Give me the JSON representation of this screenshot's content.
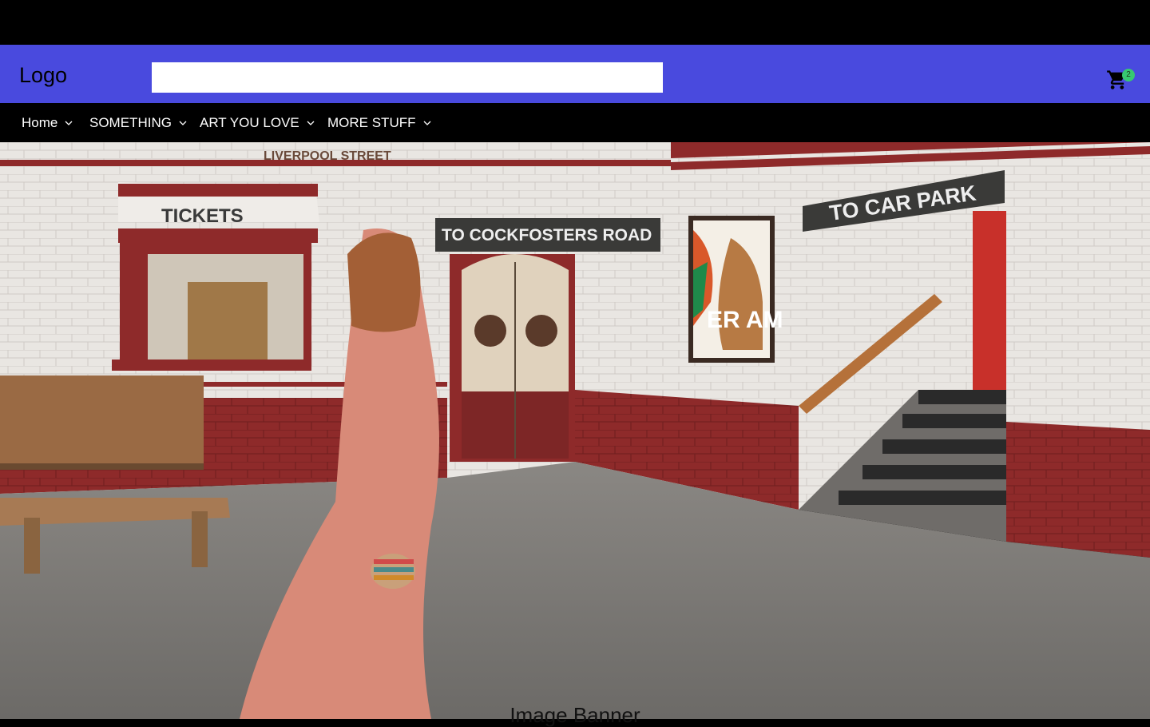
{
  "header": {
    "logo": "Logo",
    "search": {
      "value": "",
      "placeholder": ""
    },
    "cart": {
      "count": "2",
      "icon": "cart-icon"
    }
  },
  "nav": {
    "items": [
      {
        "label": "Home",
        "icon": "chevron-down-icon"
      },
      {
        "label": "SOMETHING",
        "icon": "chevron-down-icon"
      },
      {
        "label": "ART YOU LOVE",
        "icon": "chevron-down-icon"
      },
      {
        "label": "MORE STUFF",
        "icon": "chevron-down-icon"
      }
    ]
  },
  "banner": {
    "caption": "Image Banner",
    "signs": {
      "station": "LIVERPOOL STREET",
      "tickets": "TICKETS",
      "direction": "TO COCKFOSTERS ROAD",
      "car_park": "TO CAR PARK",
      "poster": "ER AM"
    }
  },
  "colors": {
    "header_bg": "#494ade",
    "nav_bg": "#000000",
    "badge": "#37c871"
  }
}
